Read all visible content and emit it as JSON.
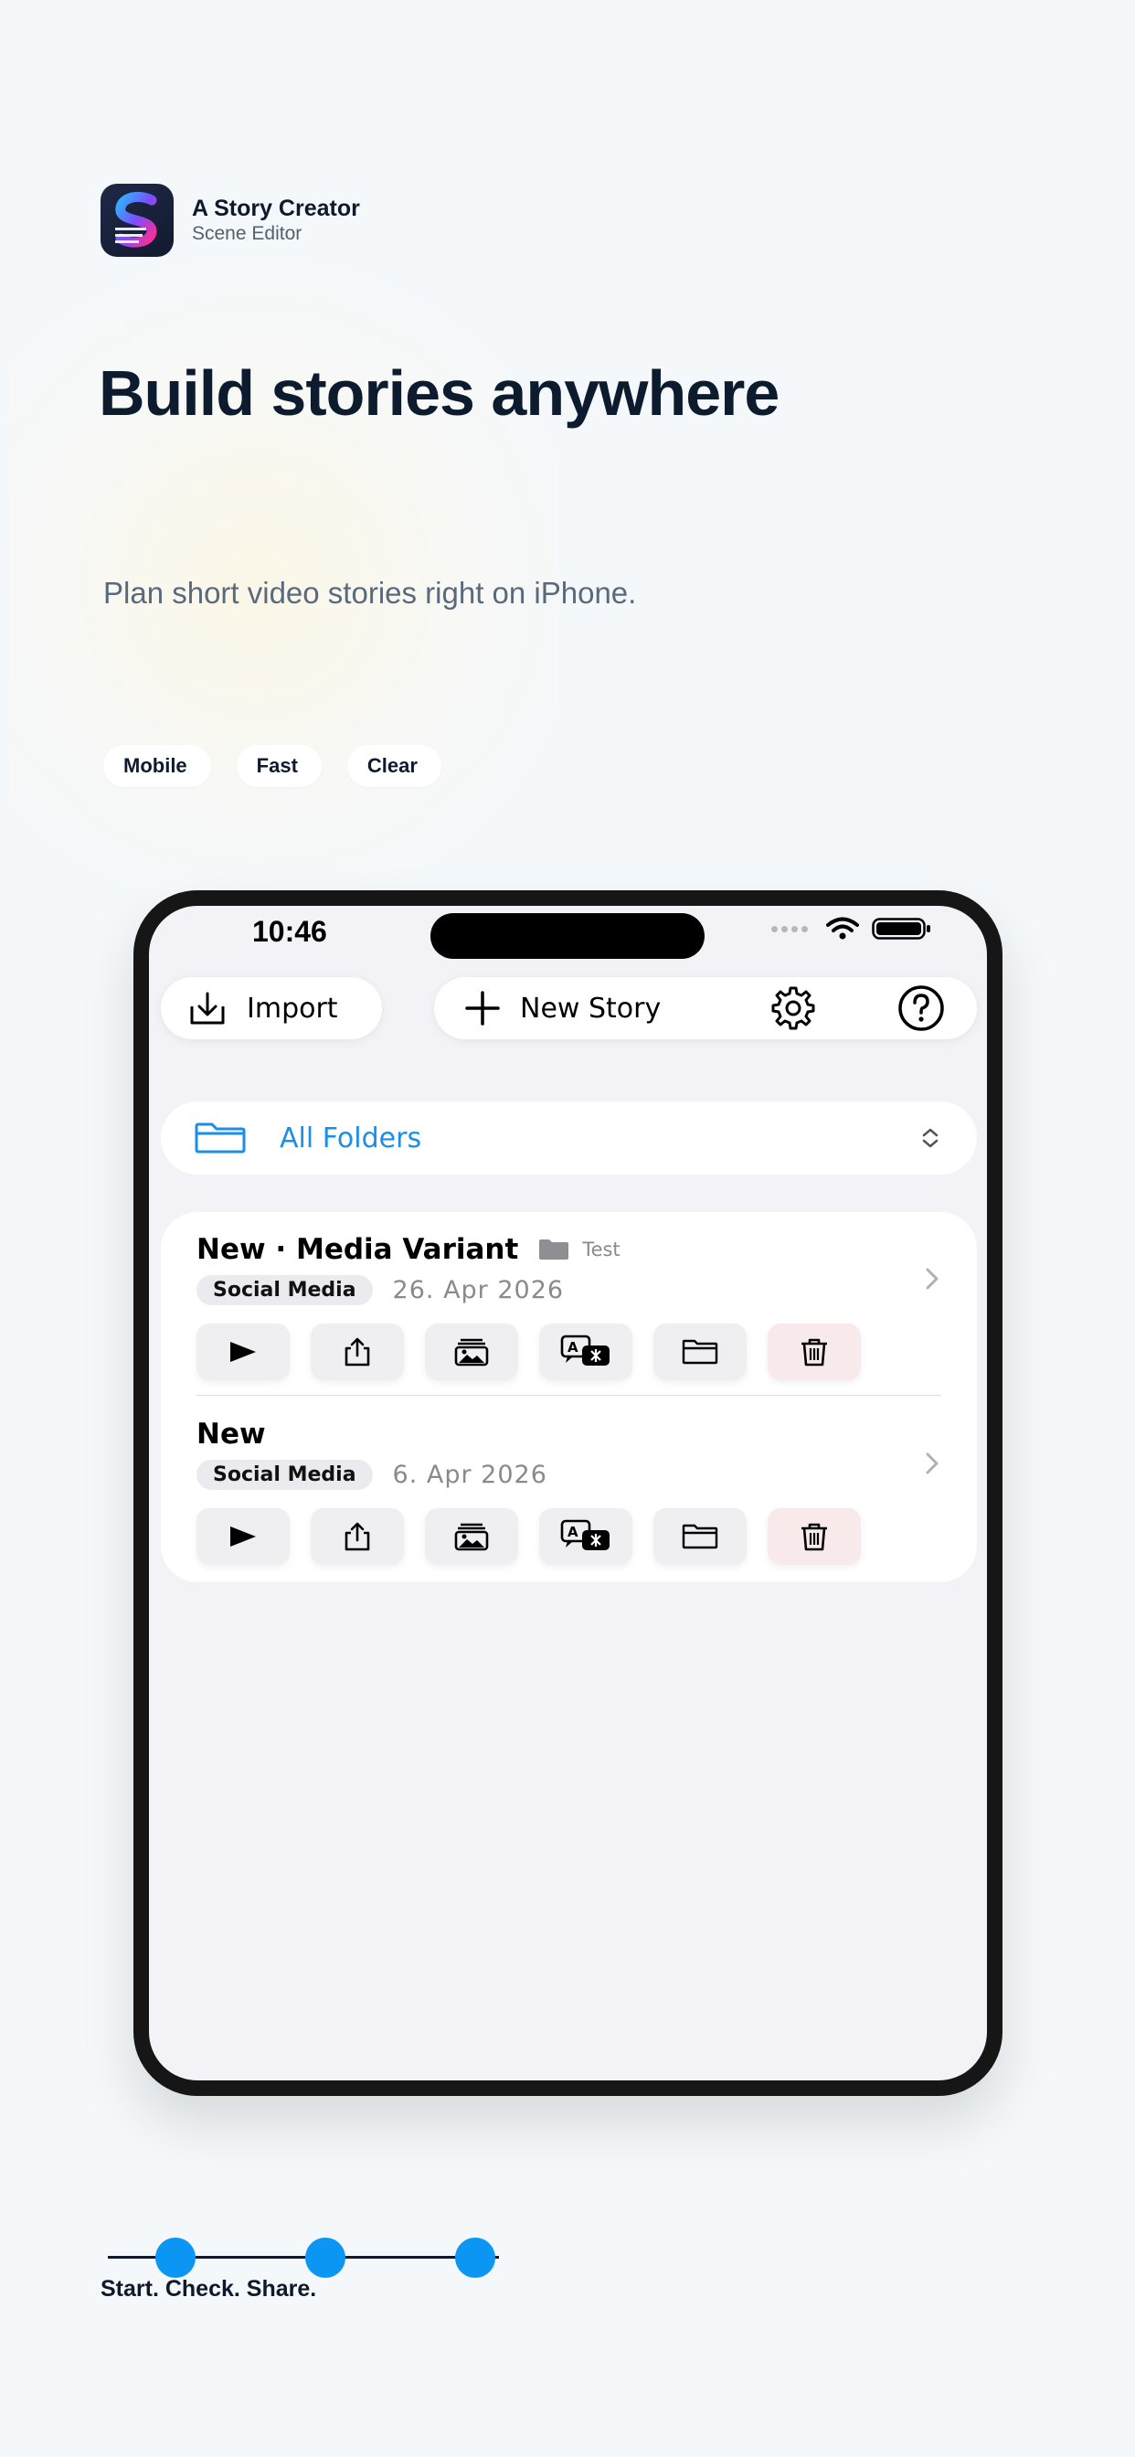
{
  "brand": {
    "app_name": "A Story Creator",
    "app_subtitle": "Scene Editor",
    "logo_icon": "story-s-logo-icon"
  },
  "hero": {
    "headline": "Build stories anywhere",
    "subline": "Plan short video stories right on iPhone.",
    "chips": [
      "Mobile",
      "Fast",
      "Clear"
    ]
  },
  "phone": {
    "status_bar": {
      "time": "10:46"
    },
    "toolbar": {
      "import_label": "Import",
      "new_story_label": "New Story",
      "settings_icon": "gear-icon",
      "help_icon": "question-circle-icon"
    },
    "folder_picker": {
      "selected": "All Folders"
    },
    "stories": [
      {
        "title": "New · Media Variant",
        "folder": "Test",
        "category": "Social Media",
        "date": "26. Apr 2026"
      },
      {
        "title": "New",
        "category": "Social Media",
        "date": "6. Apr 2026"
      }
    ],
    "action_icons": [
      "play-icon",
      "share-icon",
      "media-stack-icon",
      "translate-icon",
      "folder-icon",
      "trash-icon"
    ]
  },
  "footer": {
    "tagline": "Start. Check. Share.",
    "steps": 3
  },
  "colors": {
    "accent": "#1a8ee8",
    "step_dot": "#0c96f3",
    "headline": "#0d1b2e",
    "danger_bg": "#f8eaea"
  }
}
